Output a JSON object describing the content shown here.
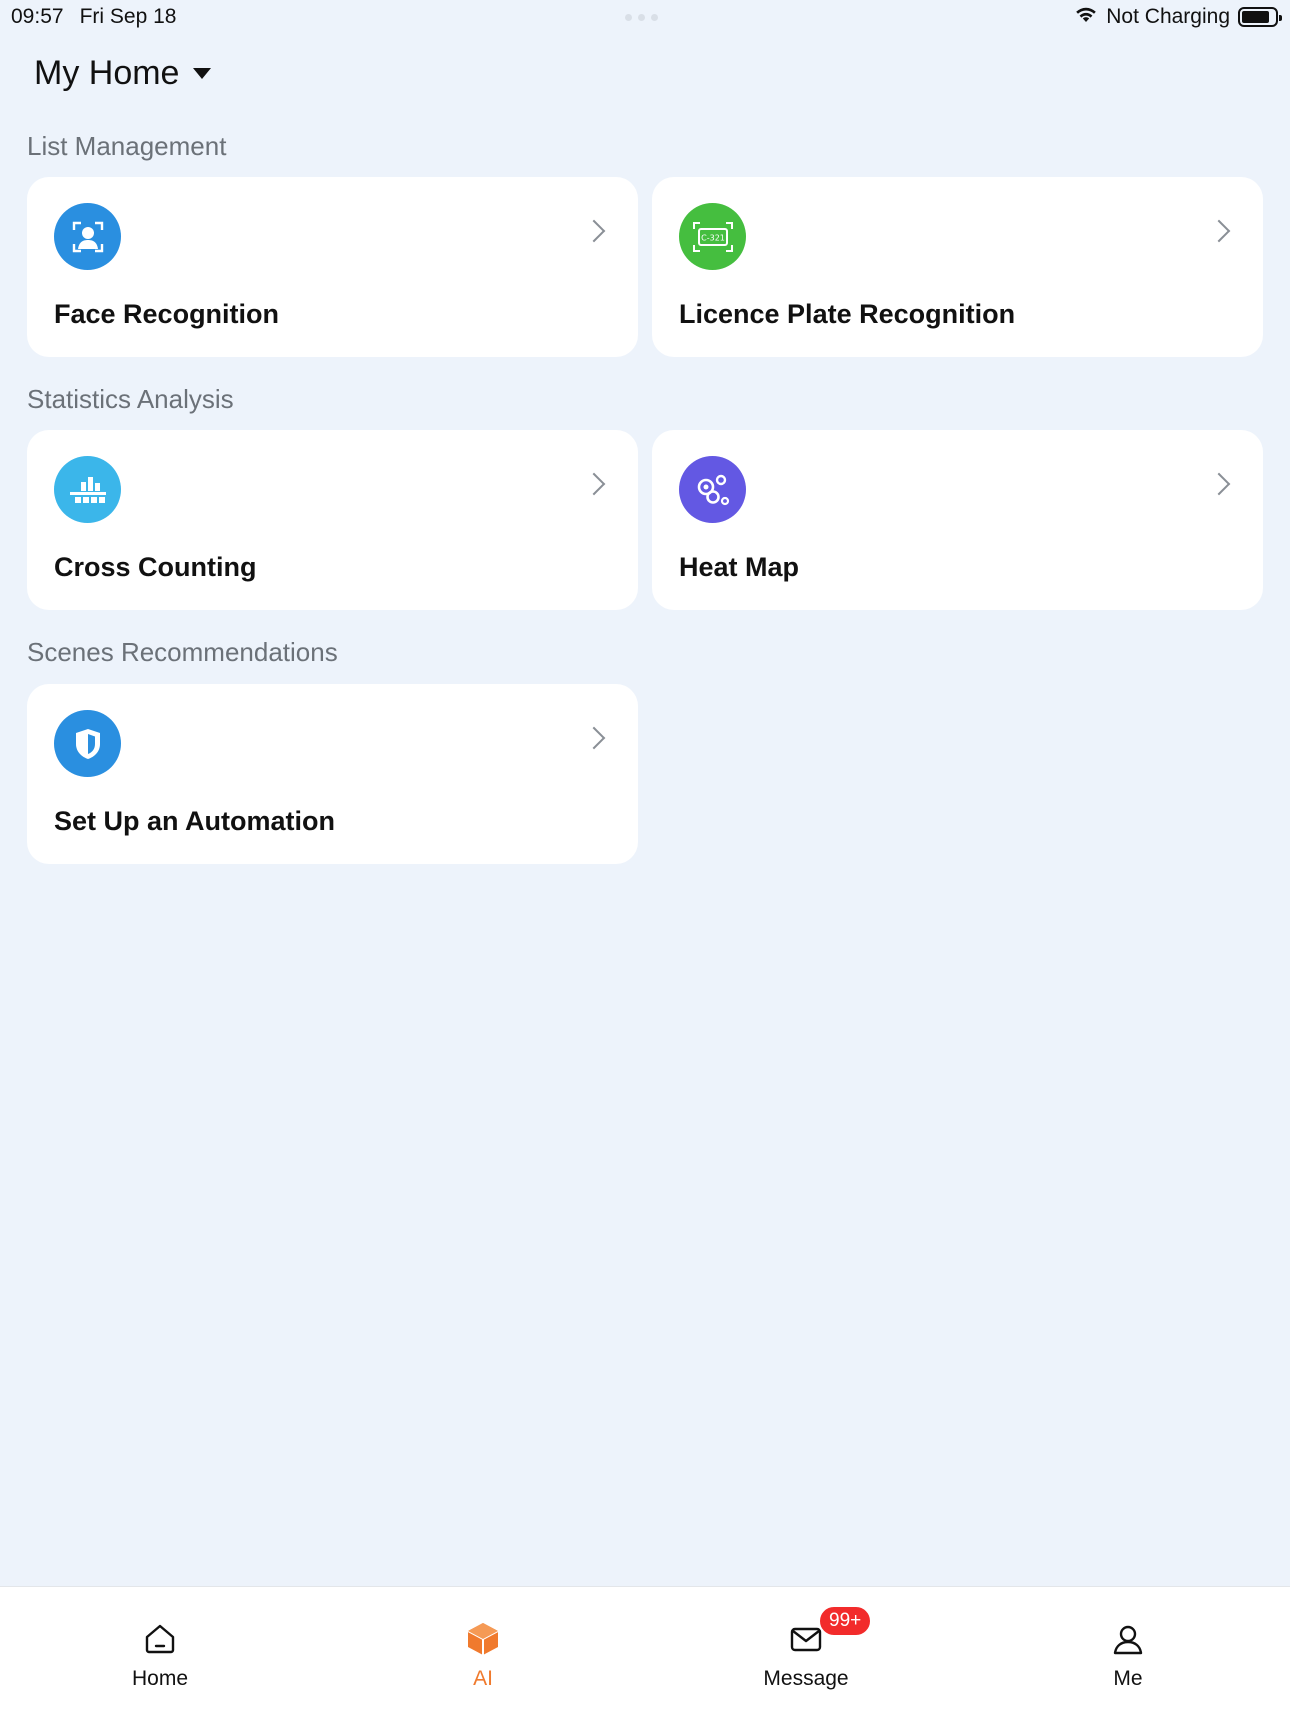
{
  "status": {
    "time": "09:57",
    "date": "Fri Sep 18",
    "charging": "Not Charging",
    "battery_level": 0.76
  },
  "header": {
    "title": "My Home"
  },
  "sections": {
    "list_management": {
      "label": "List Management",
      "items": [
        {
          "label": "Face Recognition",
          "icon": "face-recognition-icon",
          "color": "#2A8FE0"
        },
        {
          "label": "Licence Plate Recognition",
          "icon": "licence-plate-icon",
          "color": "#45BE3F",
          "plate_text": "C-321"
        }
      ]
    },
    "statistics_analysis": {
      "label": "Statistics Analysis",
      "items": [
        {
          "label": "Cross Counting",
          "icon": "cross-counting-icon",
          "color": "#3BB6EA"
        },
        {
          "label": "Heat Map",
          "icon": "heat-map-icon",
          "color": "#6358E3"
        }
      ]
    },
    "scenes_recommendations": {
      "label": "Scenes Recommendations",
      "items": [
        {
          "label": "Set Up an Automation",
          "icon": "shield-icon",
          "color": "#2A8FE0"
        }
      ]
    }
  },
  "tabs": [
    {
      "label": "Home",
      "icon": "home-icon"
    },
    {
      "label": "AI",
      "icon": "ai-cube-icon",
      "active": true
    },
    {
      "label": "Message",
      "icon": "mail-icon",
      "badge": "99+"
    },
    {
      "label": "Me",
      "icon": "person-icon"
    }
  ],
  "colors": {
    "accent": "#F07A2D",
    "badge": "#F22B2B",
    "background": "#EDF3FB"
  }
}
